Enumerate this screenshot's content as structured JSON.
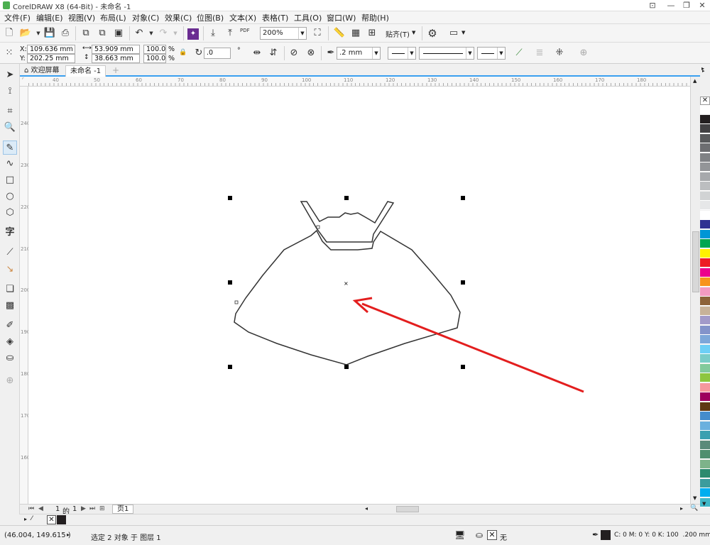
{
  "window": {
    "title": "CorelDRAW X8 (64-Bit) - 未命名 -1"
  },
  "menu": [
    "文件(F)",
    "编辑(E)",
    "视图(V)",
    "布局(L)",
    "对象(C)",
    "效果(C)",
    "位图(B)",
    "文本(X)",
    "表格(T)",
    "工具(O)",
    "窗口(W)",
    "帮助(H)"
  ],
  "toolbar": {
    "zoom": "200%",
    "snap_label": "贴齐(T)",
    "pdf_label": "PDF"
  },
  "propbar": {
    "x_label": "X:",
    "x_value": "109.636 mm",
    "y_label": "Y:",
    "y_value": "202.25 mm",
    "w_value": "53.909 mm",
    "h_value": "38.663 mm",
    "scale_w": "100.0",
    "scale_h": "100.0",
    "pct": "%",
    "rotation": ".0",
    "rotation_unit": "°",
    "outline_width": ".2 mm"
  },
  "tabs": [
    {
      "label": "欢迎屏幕"
    },
    {
      "label": "未命名 -1"
    }
  ],
  "ruler": {
    "h_ticks": [
      "40",
      "50",
      "60",
      "70",
      "80",
      "90",
      "100",
      "110",
      "120",
      "130",
      "140",
      "150",
      "160",
      "170",
      "180"
    ],
    "v_ticks": [
      "240",
      "230",
      "220",
      "210",
      "200",
      "190",
      "180",
      "170",
      "160"
    ]
  },
  "pagenav": {
    "current": "1",
    "of_label": "的",
    "total": "1",
    "page_tab": "页1"
  },
  "status": {
    "cursor_coords": "(46.004, 149.615 )",
    "selection_info": "选定 2 对象 于 图层 1",
    "fill_none": "无",
    "outline_info": "C: 0 M: 0 Y: 0 K: 100  .200 mm"
  },
  "palette_colors": [
    "#ffffff",
    "#231f20",
    "#414042",
    "#58595b",
    "#6d6e71",
    "#808285",
    "#939598",
    "#a7a9ac",
    "#bcbec0",
    "#d1d3d4",
    "#e6e7e8",
    "#ffffff",
    "#2e3192",
    "#0096d6",
    "#00a651",
    "#fff200",
    "#ed1c24",
    "#ec008c",
    "#f7941d",
    "#f49ac1",
    "#8c6239",
    "#c7b299",
    "#a29ac9",
    "#8393ca",
    "#7da7d9",
    "#6dcff6",
    "#7accc8",
    "#82ca9c",
    "#8dc63f",
    "#f5989d",
    "#9e005d",
    "#603913",
    "#448ccb",
    "#6ab0de",
    "#3aa0b0",
    "#5a8a7a",
    "#4f8f6f",
    "#7db38a",
    "#2d8a6e",
    "#3b9c9c",
    "#00aeef",
    "#3fb8c8"
  ],
  "accent": "#3aa0f0",
  "arrow_color": "#e31e1e"
}
